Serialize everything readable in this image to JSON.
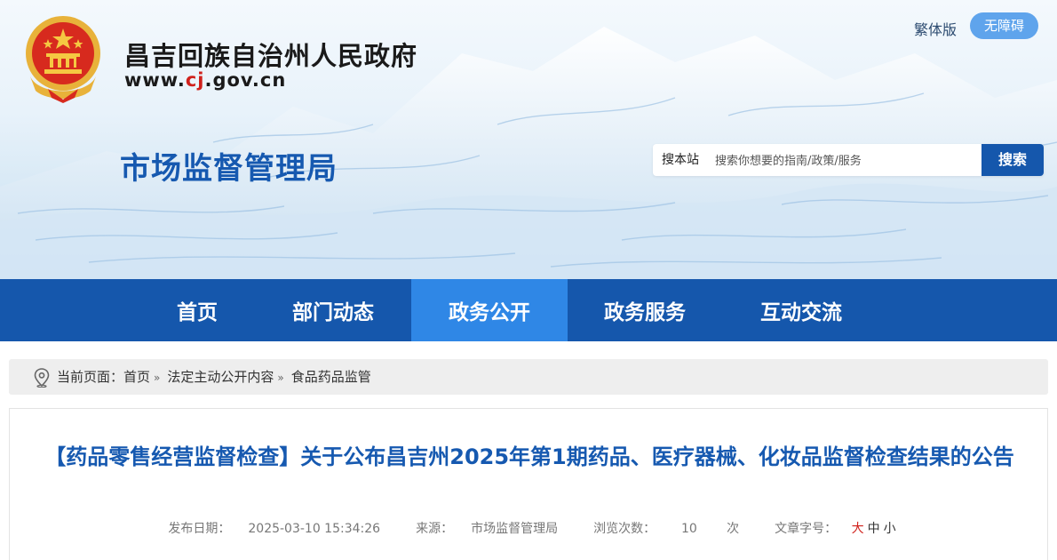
{
  "header": {
    "site_name": "昌吉回族自治州人民政府",
    "url_pre": "www.",
    "url_hl": "cj",
    "url_post": ".gov.cn",
    "dept_name": "市场监督管理局",
    "lang_link": "繁体版",
    "accessibility": "无障碍"
  },
  "search": {
    "scope": "搜本站",
    "placeholder": "搜索你想要的指南/政策/服务",
    "button": "搜索"
  },
  "nav": {
    "items": [
      "首页",
      "部门动态",
      "政务公开",
      "政务服务",
      "互动交流"
    ],
    "active": "政务公开"
  },
  "breadcrumb": {
    "prefix": "当前页面：",
    "items": [
      "首页",
      "法定主动公开内容",
      "食品药品监管"
    ],
    "separator": "»"
  },
  "article": {
    "title": "【药品零售经营监督检查】关于公布昌吉州2025年第1期药品、医疗器械、化妆品监督检查结果的公告",
    "date_label": "发布日期：",
    "date": "2025-03-10 15:34:26",
    "source_label": "来源：",
    "source": "市场监督管理局",
    "views_label": "浏览次数：",
    "views": "10",
    "views_unit": "次",
    "font_label": "文章字号：",
    "font_large": "大",
    "font_medium": "中",
    "font_small": "小"
  },
  "colors": {
    "brand_blue": "#1557ac",
    "active_nav": "#2f87e6",
    "title_blue": "#1659b0",
    "accent_red": "#d0211c"
  }
}
